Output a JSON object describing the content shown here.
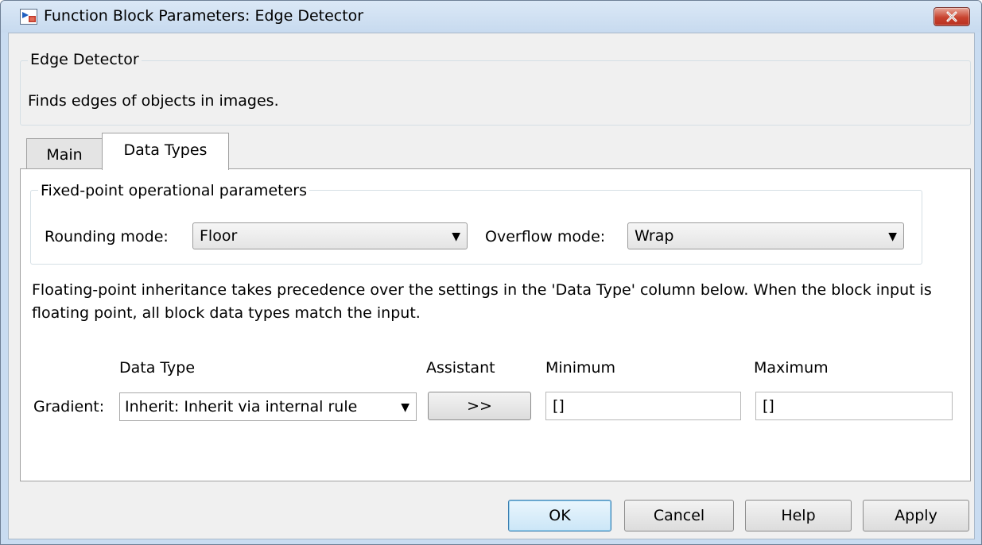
{
  "window": {
    "title": "Function Block Parameters: Edge Detector",
    "icon": "simulink-block-icon",
    "close_icon": "close-icon"
  },
  "description": {
    "group_label": "Edge Detector",
    "text": "Finds edges of objects in images."
  },
  "tabs": [
    {
      "label": "Main",
      "active": false
    },
    {
      "label": "Data Types",
      "active": true
    }
  ],
  "fixed_point": {
    "group_label": "Fixed-point operational parameters",
    "rounding_label": "Rounding mode:",
    "rounding_value": "Floor",
    "overflow_label": "Overflow mode:",
    "overflow_value": "Wrap"
  },
  "info": {
    "text": "Floating-point inheritance takes precedence over the settings in the 'Data Type' column below. When the block input is floating point, all block data types match the input."
  },
  "table": {
    "headers": {
      "data_type": "Data Type",
      "assistant": "Assistant",
      "minimum": "Minimum",
      "maximum": "Maximum"
    },
    "rows": [
      {
        "label": "Gradient:",
        "data_type": "Inherit: Inherit via internal rule",
        "assistant_label": ">>",
        "minimum": "[]",
        "maximum": "[]"
      }
    ]
  },
  "buttons": {
    "ok": "OK",
    "cancel": "Cancel",
    "help": "Help",
    "apply": "Apply"
  },
  "colors": {
    "window_frame": "#c9dcf1",
    "dialog_background": "#f0f0f0",
    "close_button": "#c8432f"
  }
}
